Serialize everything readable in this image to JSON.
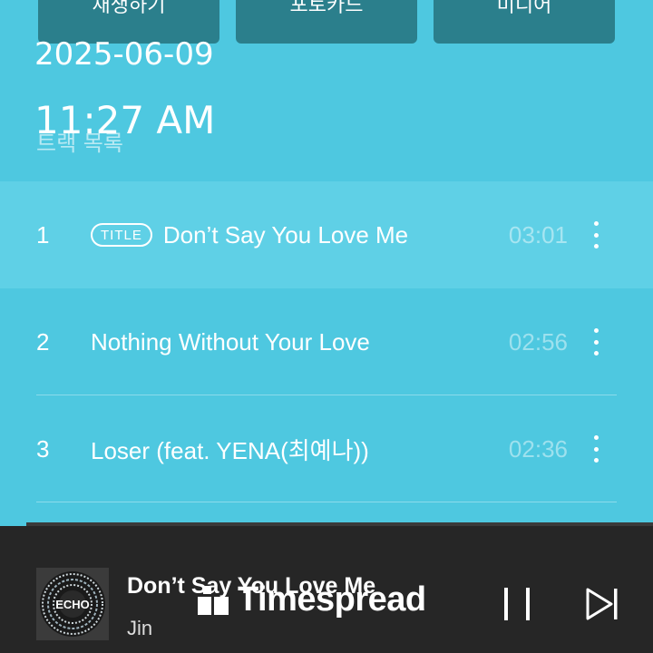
{
  "top_buttons": [
    "재생하기",
    "포토카드",
    "미디어"
  ],
  "overlay": {
    "date": "2025-06-09",
    "time": "11:27 AM"
  },
  "section_title": "트랙 목록",
  "tracks": [
    {
      "number": "1",
      "badge": "TITLE",
      "title": "Don’t Say You Love Me",
      "duration": "03:01"
    },
    {
      "number": "2",
      "badge": "",
      "title": "Nothing Without Your Love",
      "duration": "02:56"
    },
    {
      "number": "3",
      "badge": "",
      "title": "Loser (feat. YENA(최예나))",
      "duration": "02:36"
    }
  ],
  "player": {
    "title": "Don’t Say You Love Me",
    "artist": "Jin",
    "album_art_text": "ECHO",
    "progress": 0.04
  },
  "watermark": "Timespread",
  "icons": {
    "more": "more-vertical-icon",
    "pause": "pause-icon",
    "next": "skip-next-icon"
  },
  "colors": {
    "background": "#4ec8e0",
    "active_row": "#5fd0e6",
    "player_bg": "#262626",
    "button": "#2b7f8c"
  }
}
